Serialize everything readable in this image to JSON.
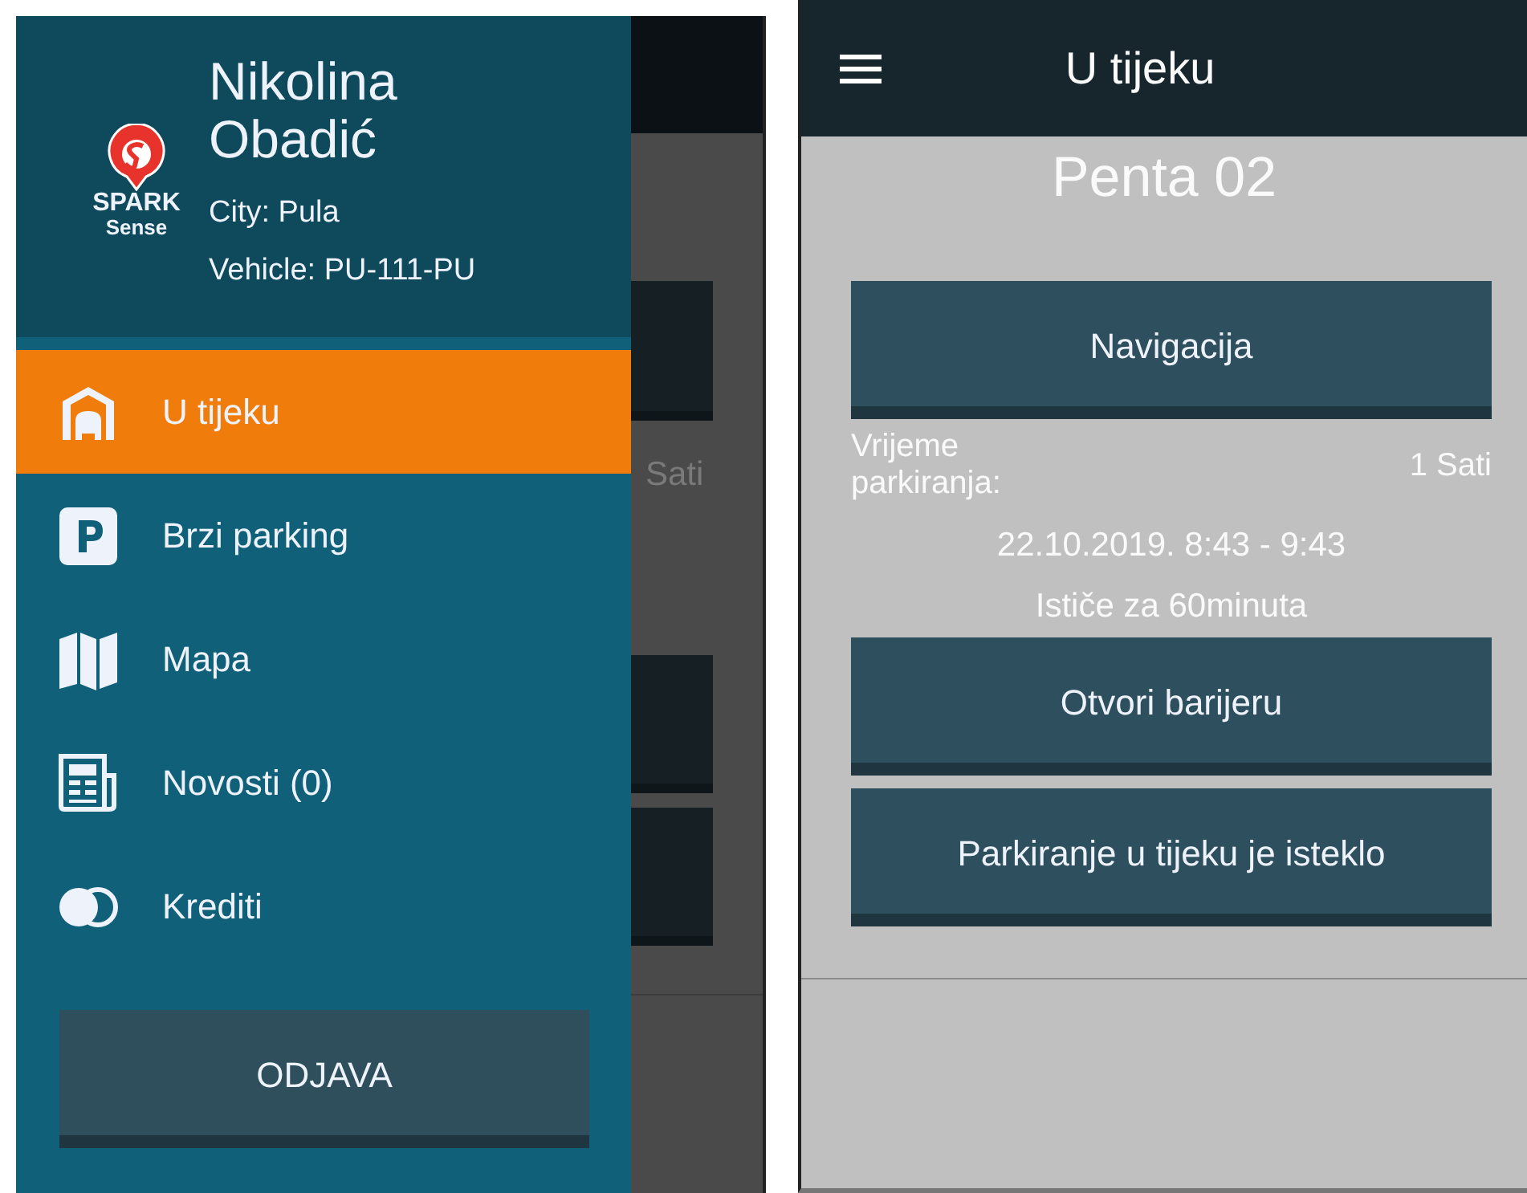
{
  "drawer": {
    "logo": {
      "word_top": "SPARK",
      "word_bottom": "Sense"
    },
    "user": {
      "name": "Nikolina Obadić",
      "city": "City: Pula",
      "vehicle": "Vehicle: PU-111-PU"
    },
    "items": [
      {
        "label": "U tijeku",
        "selected": true
      },
      {
        "label": "Brzi parking",
        "selected": false
      },
      {
        "label": "Mapa",
        "selected": false
      },
      {
        "label": "Novosti (0)",
        "selected": false
      },
      {
        "label": "Krediti",
        "selected": false
      }
    ],
    "logout_button": "ODJAVA"
  },
  "dimmed_screen": {
    "visible_text": "Sati"
  },
  "screen": {
    "title": "U tijeku",
    "location": "Penta 02",
    "buttons": [
      "Navigacija",
      "Otvori barijeru",
      "Parkiranje u tijeku je isteklo"
    ],
    "duration_label": "Vrijeme parkiranja:",
    "duration_value": "1 Sati",
    "period": "22.10.2019. 8:43 - 9:43",
    "expires": "Ističe za  60minuta"
  }
}
